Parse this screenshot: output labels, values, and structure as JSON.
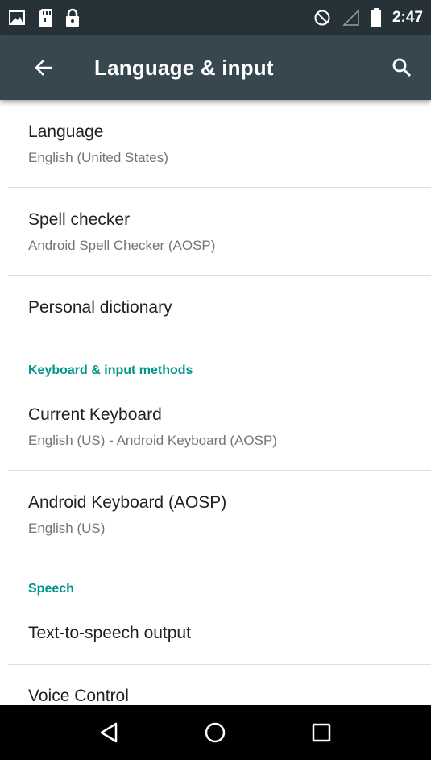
{
  "status_bar": {
    "icons": [
      "image-icon",
      "sd-card-icon",
      "lock-icon",
      "do-not-disturb-icon",
      "signal-icon",
      "battery-icon"
    ],
    "time": "2:47"
  },
  "toolbar": {
    "title": "Language & input",
    "back_icon": "arrow-back-icon",
    "search_icon": "search-icon",
    "background": "#37474f"
  },
  "accent_color": "#009688",
  "items": {
    "language": {
      "title": "Language",
      "summary": "English (United States)"
    },
    "spell_checker": {
      "title": "Spell checker",
      "summary": "Android Spell Checker (AOSP)"
    },
    "personal_dictionary": {
      "title": "Personal dictionary"
    },
    "keyboard_category": "Keyboard & input methods",
    "current_keyboard": {
      "title": "Current Keyboard",
      "summary": "English (US) - Android Keyboard (AOSP)"
    },
    "android_keyboard": {
      "title": "Android Keyboard (AOSP)",
      "summary": "English (US)"
    },
    "speech_category": "Speech",
    "tts_output": {
      "title": "Text-to-speech output"
    },
    "voice_control": {
      "title": "Voice Control"
    }
  },
  "nav_bar": {
    "buttons": [
      "back-triangle-icon",
      "home-circle-icon",
      "recents-square-icon"
    ]
  }
}
